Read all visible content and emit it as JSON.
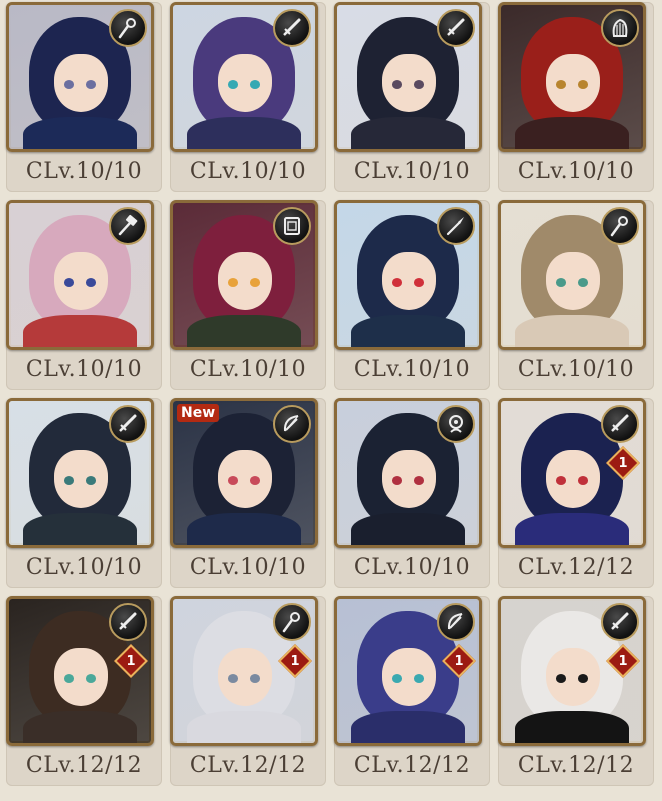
{
  "cards": [
    {
      "clv": "CLv.10/10",
      "weapon": "staff-icon",
      "new": null,
      "badge": null,
      "bg": "#b9b9c6",
      "hair": "#1d2550",
      "eyes": "#6b6fa0",
      "body": "#1c2a58"
    },
    {
      "clv": "CLv.10/10",
      "weapon": "sword-icon",
      "new": null,
      "badge": null,
      "bg": "#cdd6e2",
      "hair": "#4a3a7d",
      "eyes": "#36a9b3",
      "body": "#2d2f5c"
    },
    {
      "clv": "CLv.10/10",
      "weapon": "sword-icon",
      "new": null,
      "badge": null,
      "bg": "#d8dce6",
      "hair": "#1e2233",
      "eyes": "#5a4a60",
      "body": "#262838"
    },
    {
      "clv": "CLv.10/10",
      "weapon": "harp-icon",
      "new": null,
      "badge": null,
      "bg": "#3b2a2a",
      "hair": "#9a1f1a",
      "eyes": "#b8842e",
      "body": "#3a2020"
    },
    {
      "clv": "CLv.10/10",
      "weapon": "hammer-icon",
      "new": null,
      "badge": null,
      "bg": "#d8d0d4",
      "hair": "#d7a9bd",
      "eyes": "#3a4a9a",
      "body": "#b53a3a"
    },
    {
      "clv": "CLv.10/10",
      "weapon": "tome-icon",
      "new": null,
      "badge": null,
      "bg": "#5b2b38",
      "hair": "#7e1f3d",
      "eyes": "#e8a23a",
      "body": "#2f3a2a"
    },
    {
      "clv": "CLv.10/10",
      "weapon": "spear-icon",
      "new": null,
      "badge": null,
      "bg": "#c4d7e8",
      "hair": "#1d2a4a",
      "eyes": "#d0303a",
      "body": "#1e2f4a"
    },
    {
      "clv": "CLv.10/10",
      "weapon": "staff-icon",
      "new": null,
      "badge": null,
      "bg": "#e5dfd3",
      "hair": "#a08a6a",
      "eyes": "#4a9a8a",
      "body": "#d9c9b6"
    },
    {
      "clv": "CLv.10/10",
      "weapon": "sword-icon",
      "new": null,
      "badge": null,
      "bg": "#d7dfe6",
      "hair": "#222a3a",
      "eyes": "#3a7a7a",
      "body": "#25303a"
    },
    {
      "clv": "CLv.10/10",
      "weapon": "bow-icon",
      "new": "New",
      "badge": null,
      "bg": "#2b3346",
      "hair": "#1c2235",
      "eyes": "#c84a5a",
      "body": "#1e2a4a"
    },
    {
      "clv": "CLv.10/10",
      "weapon": "orb-icon",
      "new": null,
      "badge": null,
      "bg": "#c8cfdc",
      "hair": "#1b2233",
      "eyes": "#b03040",
      "body": "#1a1f2e"
    },
    {
      "clv": "CLv.12/12",
      "weapon": "sword-icon",
      "new": null,
      "badge": "1",
      "bg": "#e2dcd6",
      "hair": "#1b2250",
      "eyes": "#c0303a",
      "body": "#2a2c7a"
    },
    {
      "clv": "CLv.12/12",
      "weapon": "sword-icon",
      "new": null,
      "badge": "1",
      "bg": "#2a2420",
      "hair": "#3d2c22",
      "eyes": "#4aa89a",
      "body": "#3a2e28"
    },
    {
      "clv": "CLv.12/12",
      "weapon": "staff-icon",
      "new": null,
      "badge": "1",
      "bg": "#cfd4de",
      "hair": "#dcdde3",
      "eyes": "#7a8aa0",
      "body": "#d9d9df"
    },
    {
      "clv": "CLv.12/12",
      "weapon": "bow-icon",
      "new": null,
      "badge": "1",
      "bg": "#b7c0d4",
      "hair": "#3a3d8a",
      "eyes": "#3aa9b0",
      "body": "#2a2e6a"
    },
    {
      "clv": "CLv.12/12",
      "weapon": "sword-icon",
      "new": null,
      "badge": "1",
      "bg": "#d6d3cf",
      "hair": "#eae8e6",
      "eyes": "#1a1a1a",
      "body": "#141414"
    }
  ]
}
